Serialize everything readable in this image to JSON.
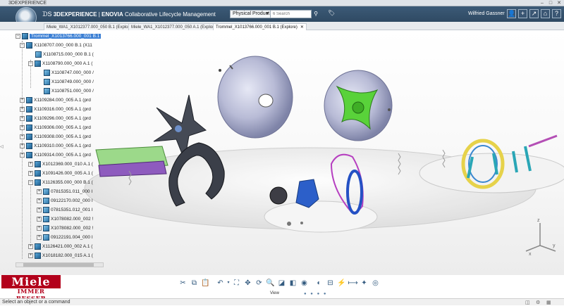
{
  "window": {
    "title": "3DEXPERIENCE"
  },
  "topbar": {
    "brand_bold": "3DEXPERIENCE",
    "brand_sep": " | ",
    "brand_app": "ENOVIA",
    "brand_desc": " Collaborative Lifecycle Management",
    "search_scope": "Physical Product",
    "search_placeholder": "6 Search",
    "user": "Wilfried Gassner"
  },
  "tabs": [
    {
      "label": "Miele_WA1_X1012377.000_050 B.1 (Explore)"
    },
    {
      "label": "Miele_WA1_X1012377.000_050 A.1 (Explore)"
    },
    {
      "label": "Trommel_X1013766.000_001 B.1 (Explore)"
    }
  ],
  "tree": {
    "root": "Trommel_X1013766.000_001 B.1",
    "rows": [
      {
        "label": "X1108707.000_000 B.1 (X11"
      },
      {
        "label": "X1108715.000_000 B.1 ("
      },
      {
        "label": "X1108790.000_000 A.1 ("
      },
      {
        "label": "X1108747.000_000 /"
      },
      {
        "label": "X1108749.000_000 /"
      },
      {
        "label": "X1108751.000_000 /"
      },
      {
        "label": "X1109284.000_005 A.1 (prd"
      },
      {
        "label": "X1109316.000_005 A.1 (prd"
      },
      {
        "label": "X1109296.000_005 A.1 (prd"
      },
      {
        "label": "X1109306.000_005 A.1 (prd"
      },
      {
        "label": "X1109308.000_005 A.1 (prd"
      },
      {
        "label": "X1109310.000_005 A.1 (prd"
      },
      {
        "label": "X1109314.000_005 A.1 (prd"
      },
      {
        "label": "X1012369.000_010 A.1 ("
      },
      {
        "label": "X1091426.000_005 A.1 ("
      },
      {
        "label": "X1126355.000_000 B.1 ("
      },
      {
        "label": "07815351.011_000 I"
      },
      {
        "label": "09122170.002_000 I"
      },
      {
        "label": "07815351.012_001 I"
      },
      {
        "label": "X1078082.000_002 !"
      },
      {
        "label": "X1078082.000_002 !"
      },
      {
        "label": "09122191.004_000 I"
      },
      {
        "label": "X1126421.000_002 A.1 ("
      },
      {
        "label": "X1018182.000_015 A.1 ("
      }
    ]
  },
  "logo": {
    "brand": "Miele",
    "slogan": "IMMER BESSER"
  },
  "actionbar": {
    "section": "View"
  },
  "status": {
    "message": "Select an object or a command"
  },
  "colors": {
    "topbar": "#2f4a63",
    "selection": "#3b7fd4",
    "miele_red": "#b3001b"
  }
}
